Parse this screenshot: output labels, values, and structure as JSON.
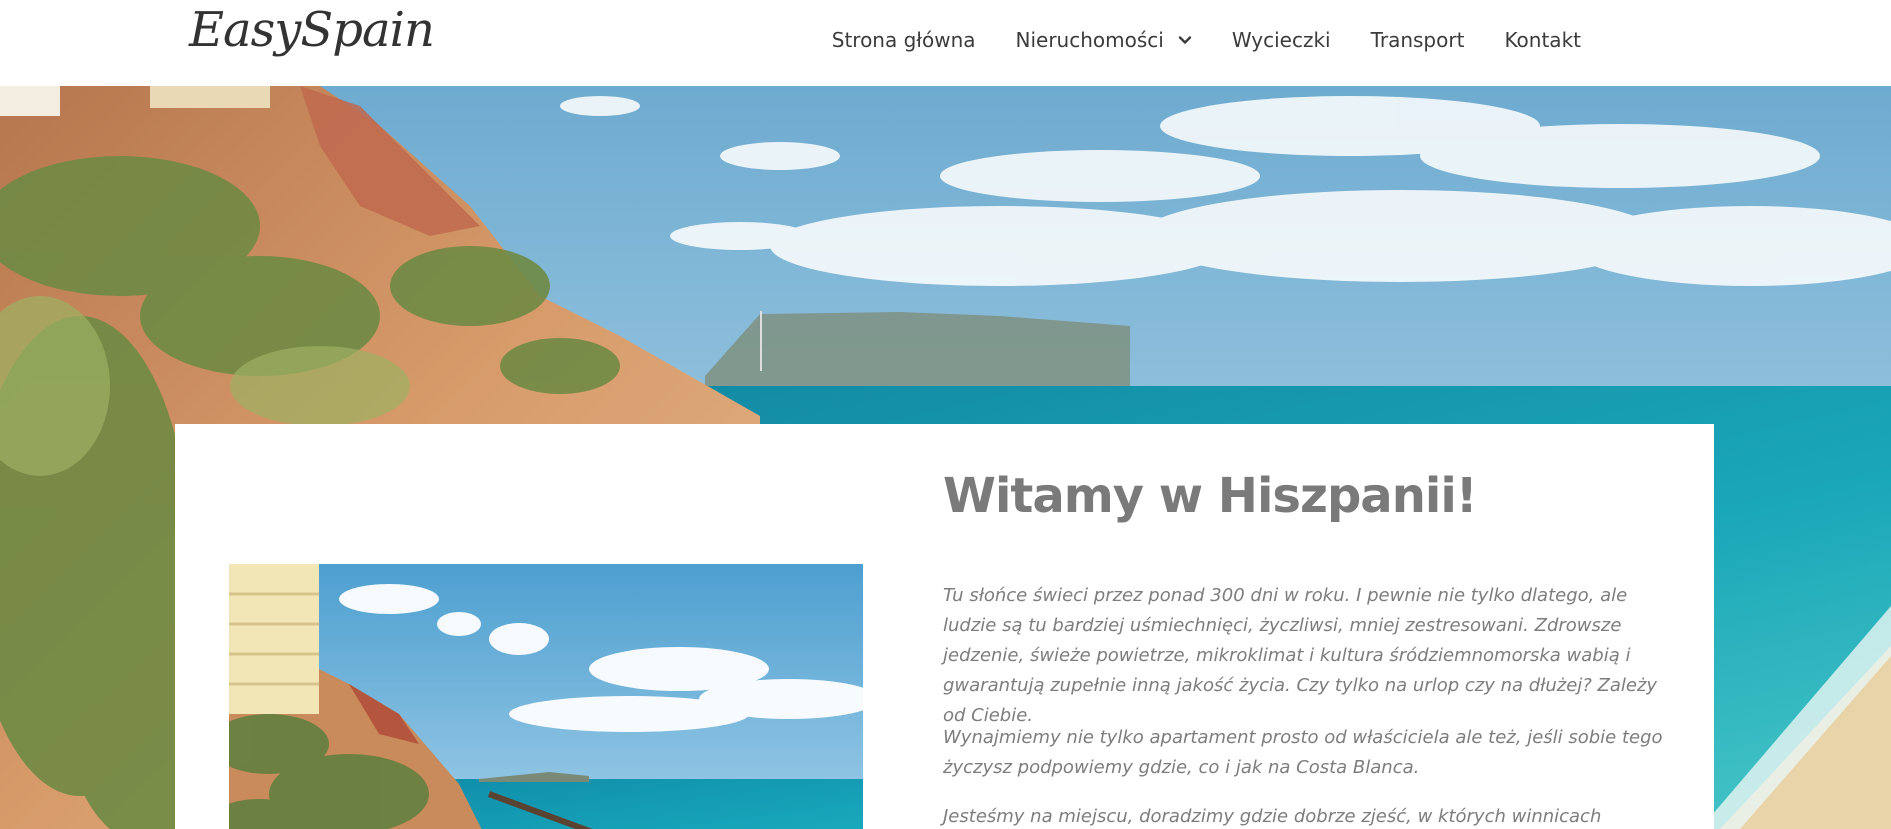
{
  "brand": {
    "logo_text": "EasySpain"
  },
  "nav": {
    "items": [
      {
        "label": "Strona główna"
      },
      {
        "label": "Nieruchomości",
        "has_dropdown": true
      },
      {
        "label": "Wycieczki"
      },
      {
        "label": "Transport"
      },
      {
        "label": "Kontakt"
      }
    ]
  },
  "main": {
    "title": "Witamy w Hiszpanii!",
    "paragraphs": [
      "Tu słońce świeci przez ponad 300 dni w roku. I pewnie nie tylko dlatego, ale ludzie są tu bardziej uśmiechnięci, życzliwsi, mniej zestresowani. Zdrowsze jedzenie, świeże powietrze, mikroklimat i kultura śródziemnomorska wabią i gwarantują zupełnie inną jakość życia. Czy tylko na urlop czy na dłużej? Zależy od Ciebie.",
      "Wynajmiemy nie tylko apartament prosto od właściciela ale też, jeśli sobie tego życzysz podpowiemy gdzie, co i jak na Costa Blanca.",
      "Jesteśmy na miejscu, doradzimy gdzie dobrze zjeść, w których winnicach"
    ]
  },
  "colors": {
    "sky": "#7fb7d6",
    "sea": "#1f9bb0",
    "cliff": "#c9845a",
    "text_gray": "#7d7d7d"
  }
}
